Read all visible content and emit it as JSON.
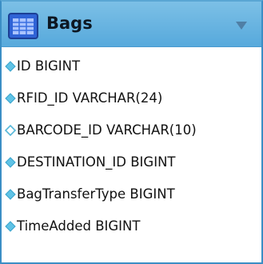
{
  "table": {
    "title": "Bags",
    "header_colors": {
      "top": "#7cc0e6",
      "bottom": "#57a9dc",
      "border": "#3b8ec5"
    },
    "icons": {
      "table": "table-icon",
      "collapse": "chevron-down-icon",
      "column": "diamond-icon"
    },
    "columns": [
      {
        "label": "ID BIGINT",
        "marker": "filled"
      },
      {
        "label": "RFID_ID VARCHAR(24)",
        "marker": "filled"
      },
      {
        "label": "BARCODE_ID VARCHAR(10)",
        "marker": "hollow"
      },
      {
        "label": "DESTINATION_ID BIGINT",
        "marker": "filled"
      },
      {
        "label": "BagTransferType BIGINT",
        "marker": "filled"
      },
      {
        "label": "TimeAdded BIGINT",
        "marker": "filled"
      }
    ]
  }
}
